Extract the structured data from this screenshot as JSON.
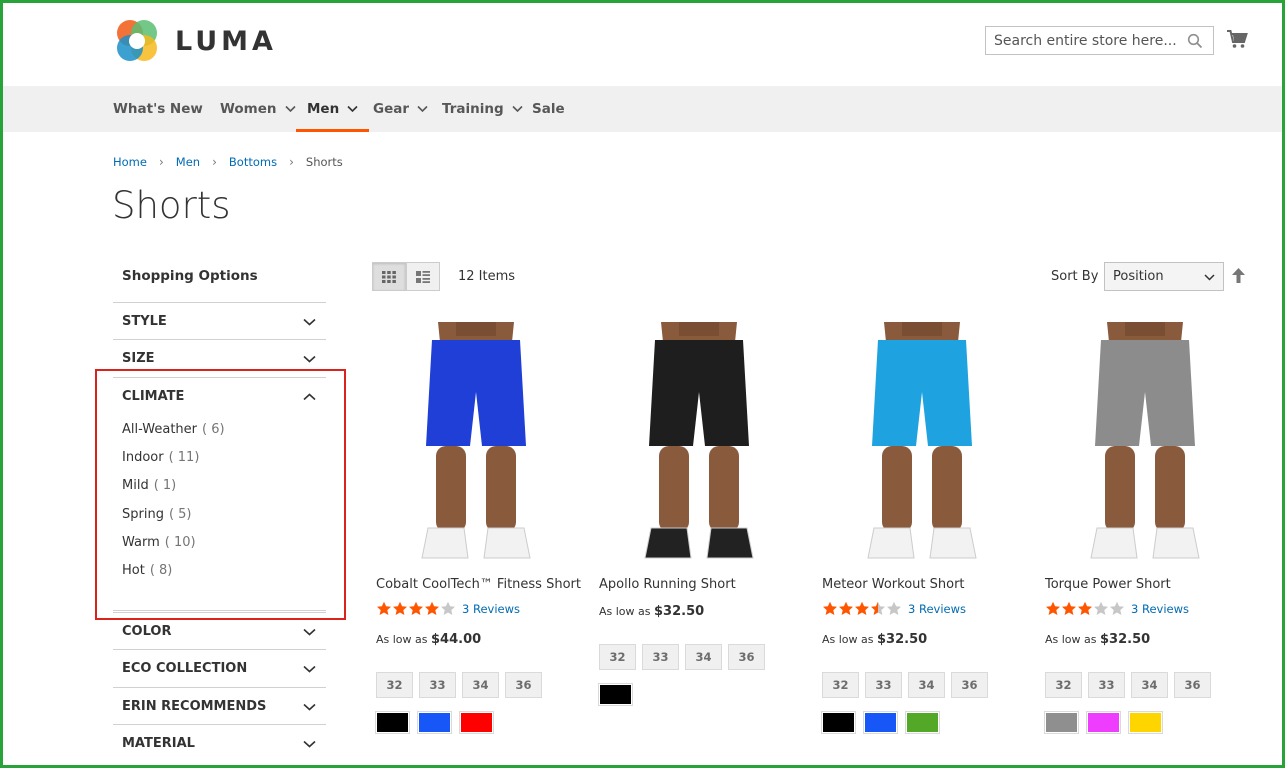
{
  "header": {
    "logo_text": "LUMA",
    "search_placeholder": "Search entire store here..."
  },
  "nav": {
    "items": [
      {
        "label": "What's New"
      },
      {
        "label": "Women"
      },
      {
        "label": "Men"
      },
      {
        "label": "Gear"
      },
      {
        "label": "Training"
      },
      {
        "label": "Sale"
      }
    ]
  },
  "breadcrumb": [
    "Home",
    "Men",
    "Bottoms",
    "Shorts"
  ],
  "page_title": "Shorts",
  "sidebar": {
    "title": "Shopping Options",
    "filters": [
      {
        "label": "STYLE"
      },
      {
        "label": "SIZE"
      },
      {
        "label": "CLIMATE",
        "expanded": true,
        "options": [
          {
            "label": "All-Weather",
            "count": "( 6)"
          },
          {
            "label": "Indoor",
            "count": "( 11)"
          },
          {
            "label": "Mild",
            "count": "( 1)"
          },
          {
            "label": "Spring",
            "count": "( 5)"
          },
          {
            "label": "Warm",
            "count": "( 10)"
          },
          {
            "label": "Hot",
            "count": "( 8)"
          }
        ]
      },
      {
        "label": "COLOR"
      },
      {
        "label": "ECO COLLECTION"
      },
      {
        "label": "ERIN RECOMMENDS"
      },
      {
        "label": "MATERIAL"
      }
    ]
  },
  "toolbar": {
    "items_count": "12 Items",
    "sort_label": "Sort By",
    "sort_value": "Position"
  },
  "products": [
    {
      "name": "Cobalt CoolTech™ Fitness Short",
      "rating": 4,
      "reviews": "3  Reviews",
      "price_prefix": "As low as",
      "price": "$44.00",
      "sizes": [
        "32",
        "33",
        "34",
        "36"
      ],
      "colors": [
        "#000000",
        "#1857f7",
        "#ff0000"
      ],
      "shorts_color": "#1f3fd6",
      "shoes_color": "#f2f2f2"
    },
    {
      "name": "Apollo Running Short",
      "rating": 0,
      "reviews": "",
      "price_prefix": "As low as",
      "price": "$32.50",
      "sizes": [
        "32",
        "33",
        "34",
        "36"
      ],
      "colors": [
        "#000000"
      ],
      "shorts_color": "#1e1e1e",
      "shoes_color": "#222222"
    },
    {
      "name": "Meteor Workout Short",
      "rating": 3.5,
      "reviews": "3  Reviews",
      "price_prefix": "As low as",
      "price": "$32.50",
      "sizes": [
        "32",
        "33",
        "34",
        "36"
      ],
      "colors": [
        "#000000",
        "#1857f7",
        "#53a828"
      ],
      "shorts_color": "#1ea3e0",
      "shoes_color": "#f2f2f2"
    },
    {
      "name": "Torque Power Short",
      "rating": 3,
      "reviews": "3  Reviews",
      "price_prefix": "As low as",
      "price": "$32.50",
      "sizes": [
        "32",
        "33",
        "34",
        "36"
      ],
      "colors": [
        "#8f8f8f",
        "#ef3dff",
        "#ffd500"
      ],
      "shorts_color": "#8c8c8c",
      "shoes_color": "#f2f2f2"
    }
  ],
  "colors": {
    "accent": "#ff5501",
    "link": "#006bb4",
    "star_on": "#ff5501",
    "star_off": "#c7c7c7",
    "highlight_box": "#d9231c"
  }
}
